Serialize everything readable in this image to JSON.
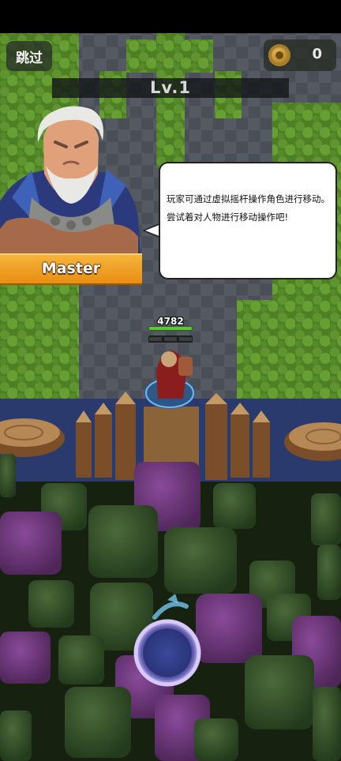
{
  "hud": {
    "skip_label": "跳过",
    "coin_icon": "gold-coin-icon",
    "coin_count": "0",
    "level_label": "Lv.1"
  },
  "tutorial": {
    "speaker_name": "Master",
    "message": "玩家可通过虚拟摇杆操作角色进行移动。尝试着对人物进行移动操作吧!"
  },
  "player": {
    "hp_value": "4782"
  },
  "joystick": {
    "icon": "joystick-icon"
  },
  "colors": {
    "grass": "#5a8a2c",
    "stone_floor": "#4a4f57",
    "water": "#2a3a6e",
    "accent_orange": "#f0a020",
    "joystick_ring": "#b8a6ff"
  }
}
